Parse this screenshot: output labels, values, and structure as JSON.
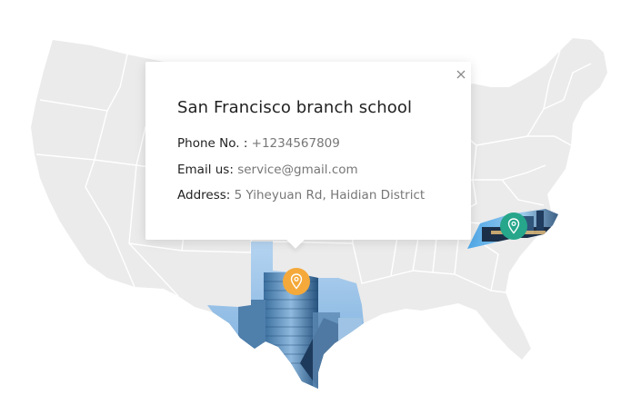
{
  "popup": {
    "title": "San Francisco branch school",
    "phone_label": "Phone No. :",
    "phone_value": "+1234567809",
    "email_label": "Email us:",
    "email_value": "service@gmail.com",
    "address_label": "Address:",
    "address_value": "5 Yiheyuan Rd, Haidian District"
  },
  "markers": [
    {
      "state": "texas",
      "color": "#f4a93a",
      "icon": "location-pin-icon"
    },
    {
      "state": "north-carolina",
      "color": "#26a68b",
      "icon": "location-pin-icon"
    }
  ],
  "colors": {
    "map_fill": "#ebebeb",
    "state_border": "#ffffff",
    "highlight_sky": "#7fb8ea",
    "highlight_building": "#2e5f8f"
  }
}
